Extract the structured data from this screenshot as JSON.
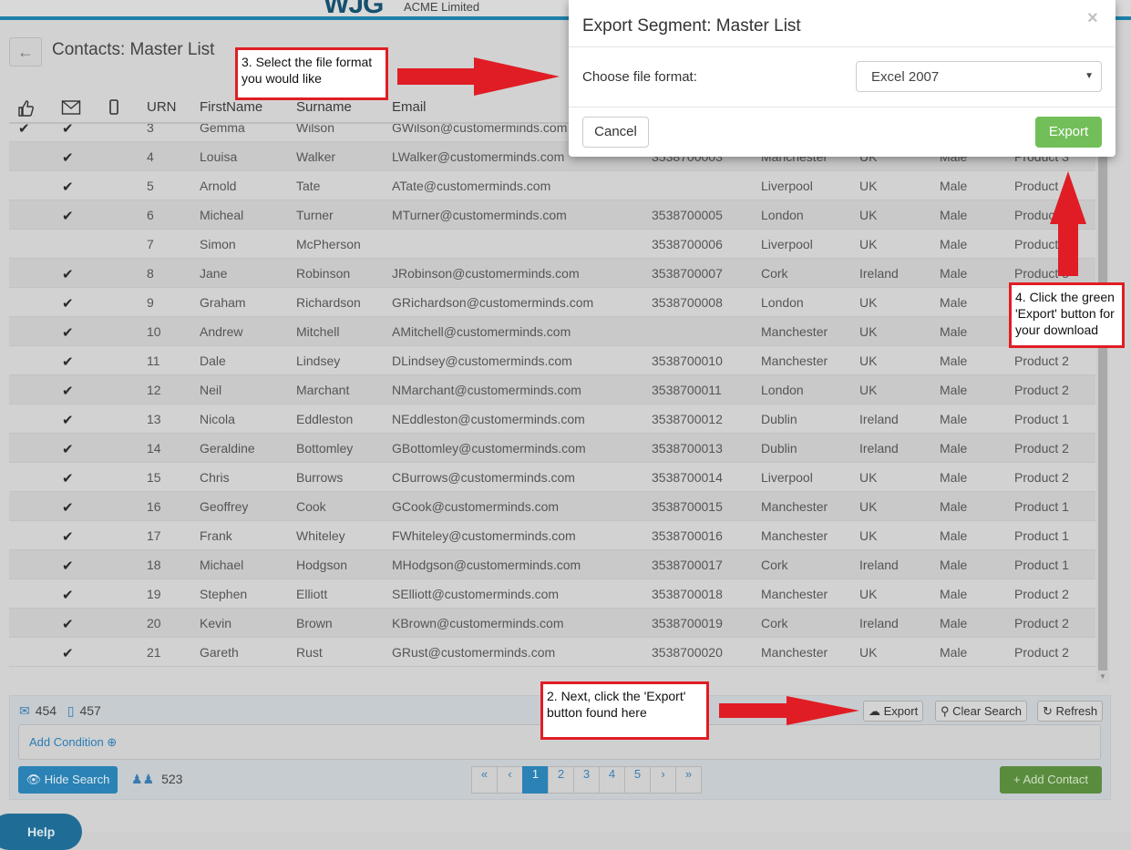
{
  "header": {
    "logo": "WJG",
    "company": "ACME Limited"
  },
  "page": {
    "title": "Contacts: Master List"
  },
  "table": {
    "columns": [
      "URN",
      "FirstName",
      "Surname",
      "Email"
    ],
    "rows": [
      {
        "liked": true,
        "email_ok": true,
        "urn": "3",
        "first": "Gemma",
        "last": "Wilson",
        "email": "GWilson@customerminds.com",
        "phone": "",
        "city": "",
        "country": "",
        "gender": "",
        "product": ""
      },
      {
        "liked": false,
        "email_ok": true,
        "urn": "4",
        "first": "Louisa",
        "last": "Walker",
        "email": "LWalker@customerminds.com",
        "phone": "3538700003",
        "city": "Manchester",
        "country": "UK",
        "gender": "Male",
        "product": "Product 3"
      },
      {
        "liked": false,
        "email_ok": true,
        "urn": "5",
        "first": "Arnold",
        "last": "Tate",
        "email": "ATate@customerminds.com",
        "phone": "",
        "city": "Liverpool",
        "country": "UK",
        "gender": "Male",
        "product": "Product"
      },
      {
        "liked": false,
        "email_ok": true,
        "urn": "6",
        "first": "Micheal",
        "last": "Turner",
        "email": "MTurner@customerminds.com",
        "phone": "3538700005",
        "city": "London",
        "country": "UK",
        "gender": "Male",
        "product": "Produc"
      },
      {
        "liked": false,
        "email_ok": false,
        "urn": "7",
        "first": "Simon",
        "last": "McPherson",
        "email": "",
        "phone": "3538700006",
        "city": "Liverpool",
        "country": "UK",
        "gender": "Male",
        "product": "Product"
      },
      {
        "liked": false,
        "email_ok": true,
        "urn": "8",
        "first": "Jane",
        "last": "Robinson",
        "email": "JRobinson@customerminds.com",
        "phone": "3538700007",
        "city": "Cork",
        "country": "Ireland",
        "gender": "Male",
        "product": "Product 3"
      },
      {
        "liked": false,
        "email_ok": true,
        "urn": "9",
        "first": "Graham",
        "last": "Richardson",
        "email": "GRichardson@customerminds.com",
        "phone": "3538700008",
        "city": "London",
        "country": "UK",
        "gender": "Male",
        "product": ""
      },
      {
        "liked": false,
        "email_ok": true,
        "urn": "10",
        "first": "Andrew",
        "last": "Mitchell",
        "email": "AMitchell@customerminds.com",
        "phone": "",
        "city": "Manchester",
        "country": "UK",
        "gender": "Male",
        "product": ""
      },
      {
        "liked": false,
        "email_ok": true,
        "urn": "11",
        "first": "Dale",
        "last": "Lindsey",
        "email": "DLindsey@customerminds.com",
        "phone": "3538700010",
        "city": "Manchester",
        "country": "UK",
        "gender": "Male",
        "product": "Product 2"
      },
      {
        "liked": false,
        "email_ok": true,
        "urn": "12",
        "first": "Neil",
        "last": "Marchant",
        "email": "NMarchant@customerminds.com",
        "phone": "3538700011",
        "city": "London",
        "country": "UK",
        "gender": "Male",
        "product": "Product 2"
      },
      {
        "liked": false,
        "email_ok": true,
        "urn": "13",
        "first": "Nicola",
        "last": "Eddleston",
        "email": "NEddleston@customerminds.com",
        "phone": "3538700012",
        "city": "Dublin",
        "country": "Ireland",
        "gender": "Male",
        "product": "Product 1"
      },
      {
        "liked": false,
        "email_ok": true,
        "urn": "14",
        "first": "Geraldine",
        "last": "Bottomley",
        "email": "GBottomley@customerminds.com",
        "phone": "3538700013",
        "city": "Dublin",
        "country": "Ireland",
        "gender": "Male",
        "product": "Product 2"
      },
      {
        "liked": false,
        "email_ok": true,
        "urn": "15",
        "first": "Chris",
        "last": "Burrows",
        "email": "CBurrows@customerminds.com",
        "phone": "3538700014",
        "city": "Liverpool",
        "country": "UK",
        "gender": "Male",
        "product": "Product 2"
      },
      {
        "liked": false,
        "email_ok": true,
        "urn": "16",
        "first": "Geoffrey",
        "last": "Cook",
        "email": "GCook@customerminds.com",
        "phone": "3538700015",
        "city": "Manchester",
        "country": "UK",
        "gender": "Male",
        "product": "Product 1"
      },
      {
        "liked": false,
        "email_ok": true,
        "urn": "17",
        "first": "Frank",
        "last": "Whiteley",
        "email": "FWhiteley@customerminds.com",
        "phone": "3538700016",
        "city": "Manchester",
        "country": "UK",
        "gender": "Male",
        "product": "Product 1"
      },
      {
        "liked": false,
        "email_ok": true,
        "urn": "18",
        "first": "Michael",
        "last": "Hodgson",
        "email": "MHodgson@customerminds.com",
        "phone": "3538700017",
        "city": "Cork",
        "country": "Ireland",
        "gender": "Male",
        "product": "Product 1"
      },
      {
        "liked": false,
        "email_ok": true,
        "urn": "19",
        "first": "Stephen",
        "last": "Elliott",
        "email": "SElliott@customerminds.com",
        "phone": "3538700018",
        "city": "Manchester",
        "country": "UK",
        "gender": "Male",
        "product": "Product 2"
      },
      {
        "liked": false,
        "email_ok": true,
        "urn": "20",
        "first": "Kevin",
        "last": "Brown",
        "email": "KBrown@customerminds.com",
        "phone": "3538700019",
        "city": "Cork",
        "country": "Ireland",
        "gender": "Male",
        "product": "Product 2"
      },
      {
        "liked": false,
        "email_ok": true,
        "urn": "21",
        "first": "Gareth",
        "last": "Rust",
        "email": "GRust@customerminds.com",
        "phone": "3538700020",
        "city": "Manchester",
        "country": "UK",
        "gender": "Male",
        "product": "Product 2"
      }
    ]
  },
  "footer": {
    "email_count": "454",
    "mobile_count": "457",
    "export_label": "Export",
    "clear_label": "Clear Search",
    "refresh_label": "Refresh",
    "add_condition": "Add Condition",
    "hide_search": "Hide Search",
    "total": "523",
    "pages": [
      "«",
      "‹",
      "1",
      "2",
      "3",
      "4",
      "5",
      "›",
      "»"
    ],
    "active_page": "1",
    "add_contact": "Add Contact"
  },
  "help": {
    "label": "Help"
  },
  "modal": {
    "title": "Export Segment: Master List",
    "close": "×",
    "label": "Choose file format:",
    "selected": "Excel 2007",
    "cancel": "Cancel",
    "export": "Export"
  },
  "annotations": {
    "step2": "2. Next, click the 'Export' button found here",
    "step3": "3. Select the file format you would like",
    "step4": "4. Click the green 'Export' button for your download"
  },
  "colors": {
    "accent": "#2a82b5",
    "export_green": "#72bf59",
    "callout_red": "#e01d24"
  }
}
